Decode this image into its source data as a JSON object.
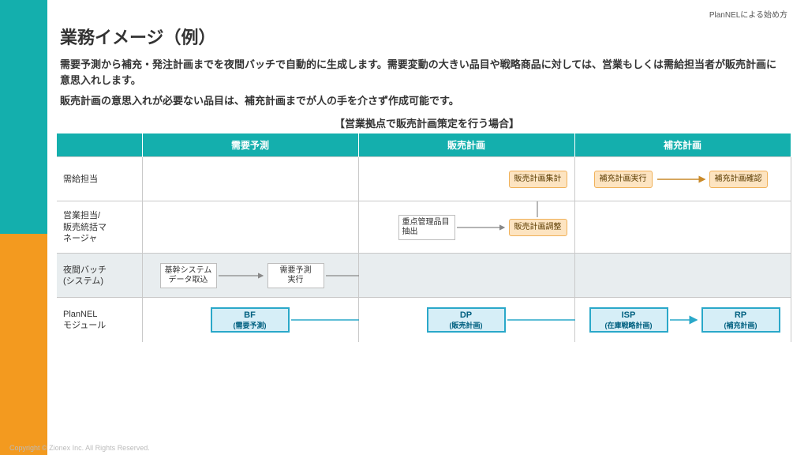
{
  "tag": "PlanNELによる始め方",
  "title": "業務イメージ（例）",
  "body1": "需要予測から補充・発注計画までを夜間バッチで自動的に生成します。需要変動の大きい品目や戦略商品に対しては、営業もしくは需給担当者が販売計画に意思入れします。",
  "body2": "販売計画の意思入れが必要ない品目は、補充計画までが人の手を介さず作成可能です。",
  "subtitle": "【営業拠点で販売計画策定を行う場合】",
  "headers": {
    "c1": "需要予測",
    "c2": "販売計画",
    "c3": "補充計画"
  },
  "rows": {
    "r1": "需給担当",
    "r2": "営業担当/\n販売統括マ\nネージャ",
    "r3": "夜間バッチ\n(システム)",
    "r4": "PlanNEL\nモジュール"
  },
  "boxes": {
    "sysA": "基幹システム\nデータ取込",
    "sysB": "需要予測\n実行",
    "salesA": "重点管理品目\n抽出",
    "salesB": "販売計画調整",
    "salesC": "販売計画集計",
    "supA": "補充計画実行",
    "supB": "補充計画確認"
  },
  "modules": {
    "bf": {
      "main": "BF",
      "sub": "(需要予測)"
    },
    "dp": {
      "main": "DP",
      "sub": "(販売計画)"
    },
    "isp": {
      "main": "ISP",
      "sub": "(在庫戦略計画)"
    },
    "rp": {
      "main": "RP",
      "sub": "(補充計画)"
    }
  },
  "footer": "Copyright © Zionex Inc. All Rights Reserved."
}
